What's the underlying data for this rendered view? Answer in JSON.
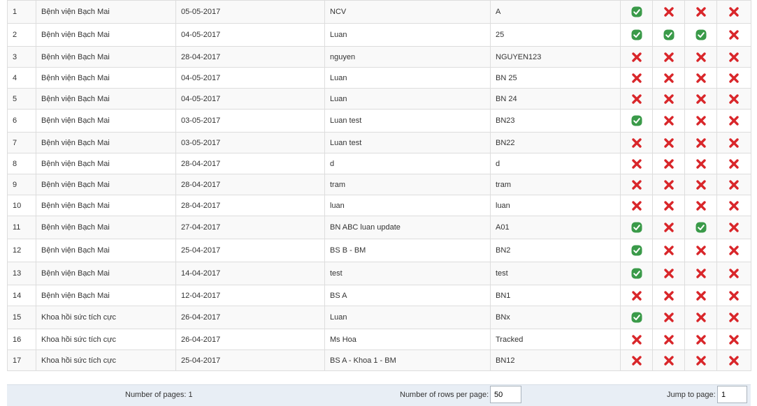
{
  "colors": {
    "check": "#3a9a49",
    "cross": "#d9262a"
  },
  "rows": [
    {
      "no": "1",
      "hospital": "Bệnh viện Bạch Mai",
      "date": "05-05-2017",
      "name": "NCV",
      "code": "A",
      "flags": [
        true,
        false,
        false,
        false
      ]
    },
    {
      "no": "2",
      "hospital": "Bệnh viện Bạch Mai",
      "date": "04-05-2017",
      "name": "Luan",
      "code": "25",
      "flags": [
        true,
        true,
        true,
        false
      ]
    },
    {
      "no": "3",
      "hospital": "Bệnh viện Bạch Mai",
      "date": "28-04-2017",
      "name": "nguyen",
      "code": "NGUYEN123",
      "flags": [
        false,
        false,
        false,
        false
      ]
    },
    {
      "no": "4",
      "hospital": "Bệnh viện Bạch Mai",
      "date": "04-05-2017",
      "name": "Luan",
      "code": "BN 25",
      "flags": [
        false,
        false,
        false,
        false
      ]
    },
    {
      "no": "5",
      "hospital": "Bệnh viện Bạch Mai",
      "date": "04-05-2017",
      "name": "Luan",
      "code": "BN 24",
      "flags": [
        false,
        false,
        false,
        false
      ]
    },
    {
      "no": "6",
      "hospital": "Bệnh viện Bạch Mai",
      "date": "03-05-2017",
      "name": "Luan test",
      "code": "BN23",
      "flags": [
        true,
        false,
        false,
        false
      ]
    },
    {
      "no": "7",
      "hospital": "Bệnh viện Bạch Mai",
      "date": "03-05-2017",
      "name": "Luan test",
      "code": "BN22",
      "flags": [
        false,
        false,
        false,
        false
      ]
    },
    {
      "no": "8",
      "hospital": "Bệnh viện Bạch Mai",
      "date": "28-04-2017",
      "name": "d",
      "code": "d",
      "flags": [
        false,
        false,
        false,
        false
      ]
    },
    {
      "no": "9",
      "hospital": "Bệnh viện Bạch Mai",
      "date": "28-04-2017",
      "name": "tram",
      "code": "tram",
      "flags": [
        false,
        false,
        false,
        false
      ]
    },
    {
      "no": "10",
      "hospital": "Bệnh viện Bạch Mai",
      "date": "28-04-2017",
      "name": "luan",
      "code": "luan",
      "flags": [
        false,
        false,
        false,
        false
      ]
    },
    {
      "no": "11",
      "hospital": "Bệnh viện Bạch Mai",
      "date": "27-04-2017",
      "name": "BN ABC luan update",
      "code": "A01",
      "flags": [
        true,
        false,
        true,
        false
      ]
    },
    {
      "no": "12",
      "hospital": "Bệnh viện Bạch Mai",
      "date": "25-04-2017",
      "name": "BS B - BM",
      "code": "BN2",
      "flags": [
        true,
        false,
        false,
        false
      ]
    },
    {
      "no": "13",
      "hospital": "Bệnh viện Bạch Mai",
      "date": "14-04-2017",
      "name": "test",
      "code": "test",
      "flags": [
        true,
        false,
        false,
        false
      ]
    },
    {
      "no": "14",
      "hospital": "Bệnh viện Bạch Mai",
      "date": "12-04-2017",
      "name": "BS A",
      "code": "BN1",
      "flags": [
        false,
        false,
        false,
        false
      ]
    },
    {
      "no": "15",
      "hospital": "Khoa hồi sức tích cực",
      "date": "26-04-2017",
      "name": "Luan",
      "code": "BNx",
      "flags": [
        true,
        false,
        false,
        false
      ]
    },
    {
      "no": "16",
      "hospital": "Khoa hồi sức tích cực",
      "date": "26-04-2017",
      "name": "Ms Hoa",
      "code": "Tracked",
      "flags": [
        false,
        false,
        false,
        false
      ]
    },
    {
      "no": "17",
      "hospital": "Khoa hồi sức tích cực",
      "date": "25-04-2017",
      "name": "BS A - Khoa 1 - BM",
      "code": "BN12",
      "flags": [
        false,
        false,
        false,
        false
      ]
    }
  ],
  "footer": {
    "pages_label": "Number of pages: 1",
    "rows_per_page_label": "Number of rows per page:",
    "rows_per_page_value": "50",
    "jump_label": "Jump to page:",
    "jump_value": "1"
  }
}
